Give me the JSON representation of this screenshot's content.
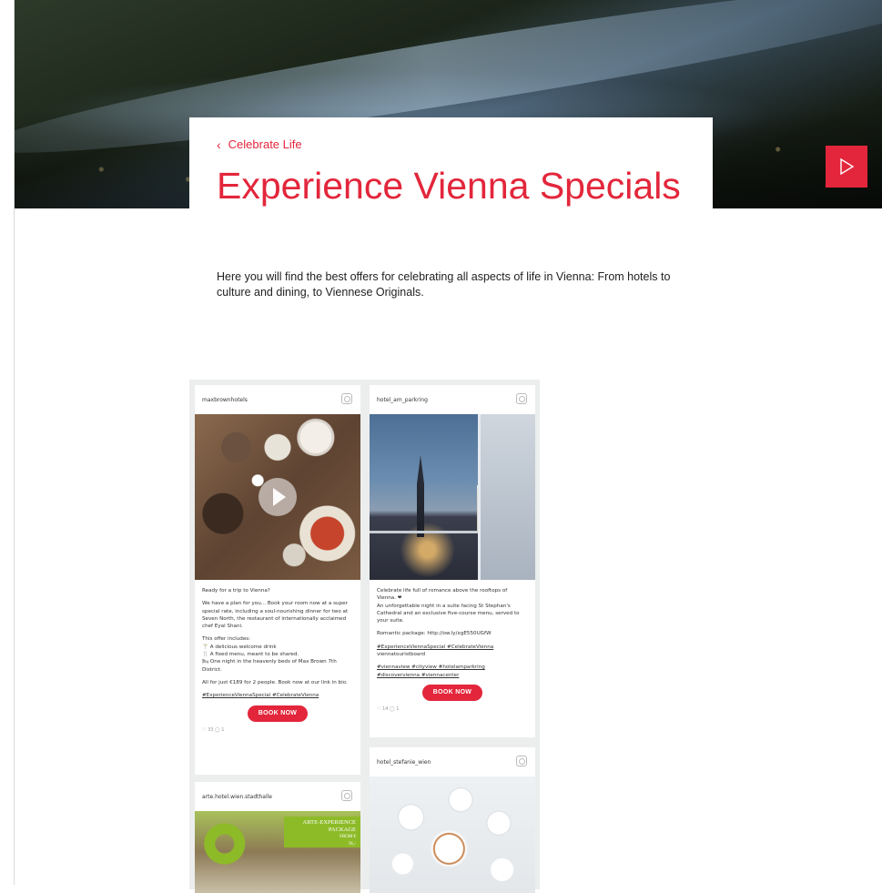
{
  "hero": {
    "breadcrumb": "Celebrate Life",
    "title": "Experience Vienna Specials",
    "intro": "Here you will find the best offers for celebrating all aspects of life in Vienna: From hotels to culture and dining, to Viennese Originals."
  },
  "colors": {
    "accent": "#e3263b",
    "feed_bg": "#eceeee"
  },
  "icons": {
    "breadcrumb": "chevron-left-icon",
    "next": "play-arrow-icon",
    "post": "instagram-icon"
  },
  "feed": {
    "posts": [
      {
        "user": "maxbrownhotels",
        "caption": [
          "Ready for a trip to Vienna?",
          "We have a plan for you... Book your room now at a super special rate, including a soul-nourishing dinner for two at Seven North, the restaurant of internationally acclaimed chef Eyal Shani.",
          "This offer includes:\n🍸 A delicious welcome drink\n🍴 A fixed menu, meant to be shared.\n🛏 One night in the heavenly beds of Max Brown 7th District.",
          "All for just €189 for 2 people. Book now at our link in bio."
        ],
        "tags": "#ExperienceViennaSpecial #CelebrateVienna",
        "button": "BOOK NOW",
        "stats": "♡ 33  ◯ 1"
      },
      {
        "user": "hotel_am_parkring",
        "caption": [
          "Celebrate life full of romance above the rooftops of Vienna. ❤\nAn unforgettable night in a suite facing St Stephan's Cathedral and an exclusive five-course menu, served to your suite.",
          "Romantic package: http://ow.ly/xgE550UGfW"
        ],
        "tags": "#ExperienceViennaSpecial #CelebrateVienna",
        "tags_extra": "viennatouristboard",
        "tags2": "#viennaview #cityview #hotelamparkring #discovervienna #viennacenter",
        "button": "BOOK NOW",
        "stats": "♡ 14  ◯ 1"
      },
      {
        "user": "hotel_stefanie_wien"
      },
      {
        "user": "arte.hotel.wien.stadthalle",
        "overlay": [
          "ARTE-EXPERIENCE",
          "PACKAGE",
          "FROM €",
          "91,-"
        ]
      }
    ]
  }
}
